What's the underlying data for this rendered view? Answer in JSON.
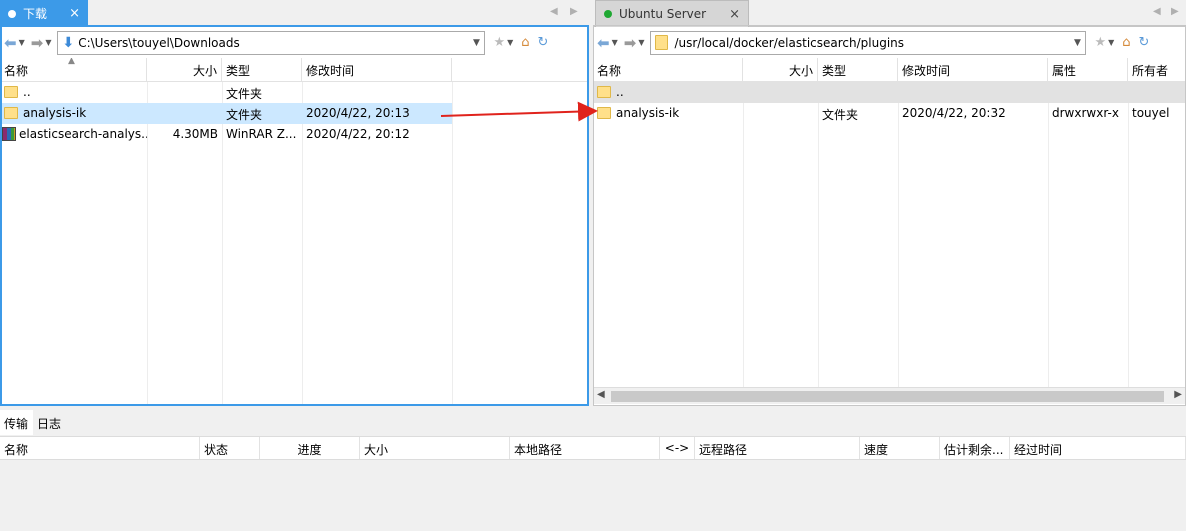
{
  "left_pane": {
    "tab": {
      "label": "下载",
      "status_color": "#ffffff"
    },
    "toolbar": {
      "path": "C:\\Users\\touyel\\Downloads"
    },
    "columns": [
      "名称",
      "大小",
      "类型",
      "修改时间"
    ],
    "rows": [
      {
        "name": "..",
        "size": "",
        "type": "文件夹",
        "modified": "",
        "icon": "folder-icon"
      },
      {
        "name": "analysis-ik",
        "size": "",
        "type": "文件夹",
        "modified": "2020/4/22, 20:13",
        "icon": "folder-icon",
        "selected": true
      },
      {
        "name": "elasticsearch-analys...",
        "size": "4.30MB",
        "type": "WinRAR Z...",
        "modified": "2020/4/22, 20:12",
        "icon": "winrar-archive-icon"
      }
    ]
  },
  "right_pane": {
    "tab": {
      "label": "Ubuntu Server",
      "status_color": "#1fa832"
    },
    "toolbar": {
      "path": "/usr/local/docker/elasticsearch/plugins"
    },
    "columns": [
      "名称",
      "大小",
      "类型",
      "修改时间",
      "属性",
      "所有者"
    ],
    "rows": [
      {
        "name": "..",
        "size": "",
        "type": "",
        "modified": "",
        "attributes": "",
        "owner": "",
        "icon": "folder-icon",
        "highlighted": true
      },
      {
        "name": "analysis-ik",
        "size": "",
        "type": "文件夹",
        "modified": "2020/4/22, 20:32",
        "attributes": "drwxrwxr-x",
        "owner": "touyel",
        "icon": "folder-icon"
      }
    ]
  },
  "transfer_panel": {
    "tabs": [
      "传输",
      "日志"
    ],
    "active_tab": "传输",
    "columns": [
      "名称",
      "状态",
      "进度",
      "大小",
      "本地路径",
      "<->",
      "远程路径",
      "速度",
      "估计剩余...",
      "经过时间"
    ]
  },
  "colors": {
    "accent": "#3c9ae8",
    "selection": "#cce8ff",
    "row_highlight": "#e2e2e2",
    "arrow": "#e0231c"
  }
}
